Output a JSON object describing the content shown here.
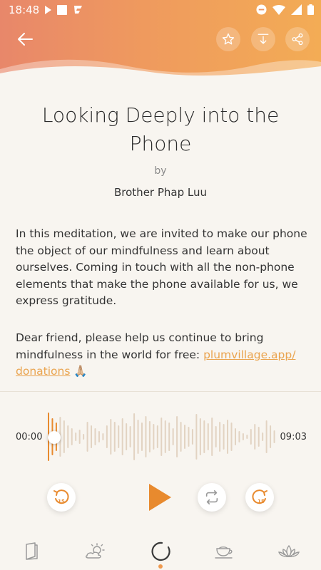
{
  "status_bar": {
    "time": "18:48",
    "icons": [
      "play-icon",
      "square-icon",
      "app-icon",
      "dnd-icon",
      "wifi-icon",
      "signal-icon",
      "battery-icon"
    ]
  },
  "header": {
    "back_icon": "arrow-left-icon",
    "actions": [
      "star-icon",
      "download-icon",
      "share-icon"
    ],
    "gradient": [
      "#e8876a",
      "#f3ac55"
    ]
  },
  "meditation": {
    "title": "Looking Deeply into the Phone",
    "by": "by",
    "author": "Brother Phap Luu",
    "description": "In this meditation, we are invited to make our phone the object of our mindfulness and learn about ourselves. Coming in touch with all the non-phone elements that make the phone available for us, we express gratitude.",
    "appeal_text": "Dear friend, please help us continue to bring mindfulness in the world for free: ",
    "appeal_link": "plumvillage.app/ donations",
    "appeal_emoji": "🙏🏼"
  },
  "player": {
    "current_time": "00:00",
    "total_time": "09:03",
    "progress": 0.0,
    "rewind_label": "15",
    "forward_label": "15",
    "accent": "#e88a2e",
    "wave_color": "#e2d3c2"
  },
  "bottom_nav": {
    "items": [
      "book-icon",
      "sun-cloud-icon",
      "enso-circle-icon",
      "tea-cup-icon",
      "lotus-icon"
    ],
    "active_index": 2
  }
}
